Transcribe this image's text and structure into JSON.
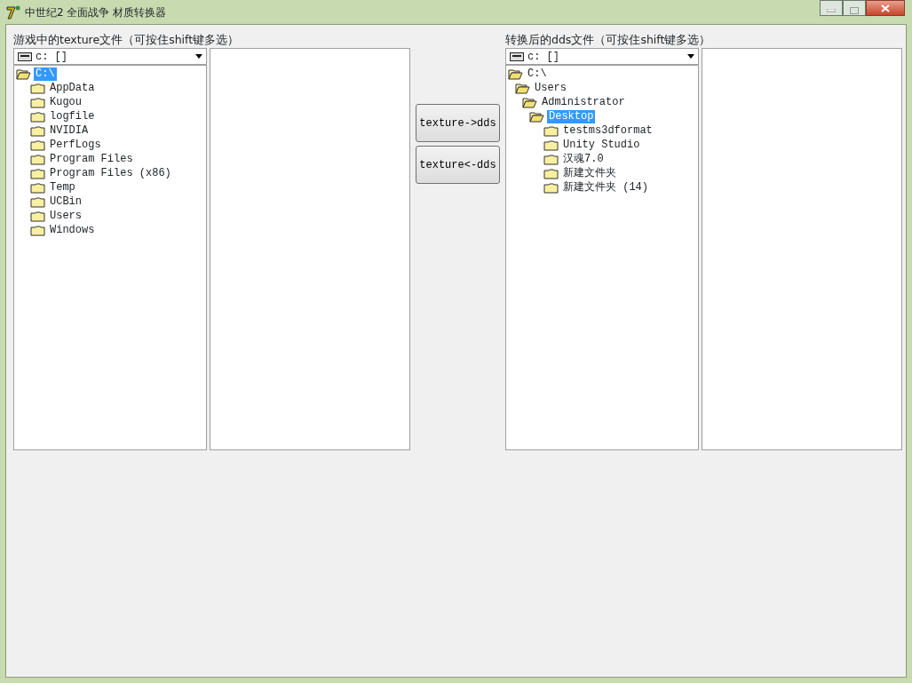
{
  "window": {
    "title": "中世纪2 全面战争 材质转换器"
  },
  "left": {
    "label": "游戏中的texture文件（可按住shift键多选）",
    "drive": "c: []",
    "tree": [
      {
        "label": "C:\\",
        "expanded": true,
        "selected": true,
        "children": [
          {
            "label": "AppData",
            "expanded": false,
            "selected": false
          },
          {
            "label": "Kugou",
            "expanded": false,
            "selected": false
          },
          {
            "label": "logfile",
            "expanded": false,
            "selected": false
          },
          {
            "label": "NVIDIA",
            "expanded": false,
            "selected": false
          },
          {
            "label": "PerfLogs",
            "expanded": false,
            "selected": false
          },
          {
            "label": "Program Files",
            "expanded": false,
            "selected": false
          },
          {
            "label": "Program Files (x86)",
            "expanded": false,
            "selected": false
          },
          {
            "label": "Temp",
            "expanded": false,
            "selected": false
          },
          {
            "label": "UCBin",
            "expanded": false,
            "selected": false
          },
          {
            "label": "Users",
            "expanded": false,
            "selected": false
          },
          {
            "label": "Windows",
            "expanded": false,
            "selected": false
          }
        ]
      }
    ]
  },
  "buttons": [
    "texture->dds",
    "texture<-dds"
  ],
  "right": {
    "label": "转换后的dds文件（可按住shift键多选）",
    "drive": "c: []",
    "tree": [
      {
        "label": "C:\\",
        "expanded": true,
        "selected": false,
        "children": [
          {
            "label": "Users",
            "expanded": true,
            "selected": false,
            "children": [
              {
                "label": "Administrator",
                "expanded": true,
                "selected": false,
                "children": [
                  {
                    "label": "Desktop",
                    "expanded": true,
                    "selected": true,
                    "children": [
                      {
                        "label": "testms3dformat",
                        "expanded": false,
                        "selected": false
                      },
                      {
                        "label": "Unity Studio",
                        "expanded": false,
                        "selected": false
                      },
                      {
                        "label": "汉魂7.0",
                        "expanded": false,
                        "selected": false
                      },
                      {
                        "label": "新建文件夹",
                        "expanded": false,
                        "selected": false
                      },
                      {
                        "label": "新建文件夹 (14)",
                        "expanded": false,
                        "selected": false
                      }
                    ]
                  }
                ]
              }
            ]
          }
        ]
      }
    ]
  }
}
